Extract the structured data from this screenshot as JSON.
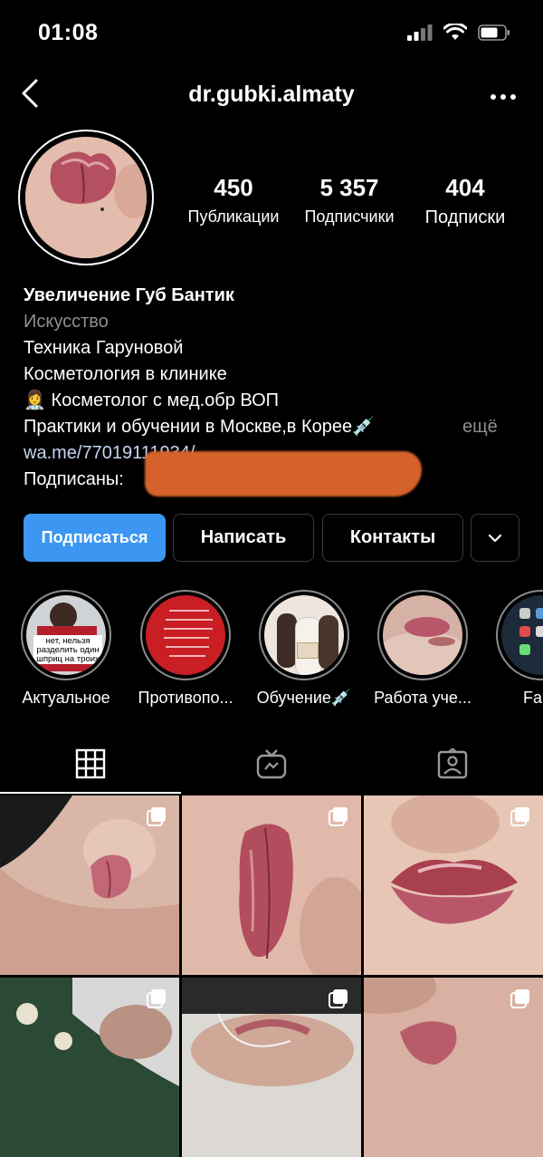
{
  "status_bar": {
    "time": "01:08"
  },
  "header": {
    "username": "dr.gubki.almaty"
  },
  "stats": [
    {
      "value": "450",
      "label": "Публикации"
    },
    {
      "value": "5 357",
      "label": "Подписчики"
    },
    {
      "value": "404",
      "label": "Подписки"
    }
  ],
  "bio": {
    "name": "Увеличение Губ Бантик",
    "category": "Искусство",
    "lines": [
      "Техника Гаруновой",
      "Косметология в клинике",
      "👩‍⚕️ Косметолог с мед.обр ВОП",
      "Практики и обучении в Москве,в Корее💉"
    ],
    "more": "ещё",
    "link": "wa.me/77019111934/",
    "followed_by_label": "Подписаны: "
  },
  "buttons": {
    "follow": "Подписаться",
    "message": "Написать",
    "contacts": "Контакты"
  },
  "highlights": [
    {
      "label": "Актуальное",
      "sign_text": "нет, нельзя разделить один шприц на троих"
    },
    {
      "label": "Противопо..."
    },
    {
      "label": "Обучение💉"
    },
    {
      "label": "Работа уче..."
    },
    {
      "label": "Fa"
    }
  ],
  "colors": {
    "accent": "#3b97f2",
    "background": "#000000",
    "secondary_text": "#8e8e8e",
    "link": "#c7d3f2"
  }
}
